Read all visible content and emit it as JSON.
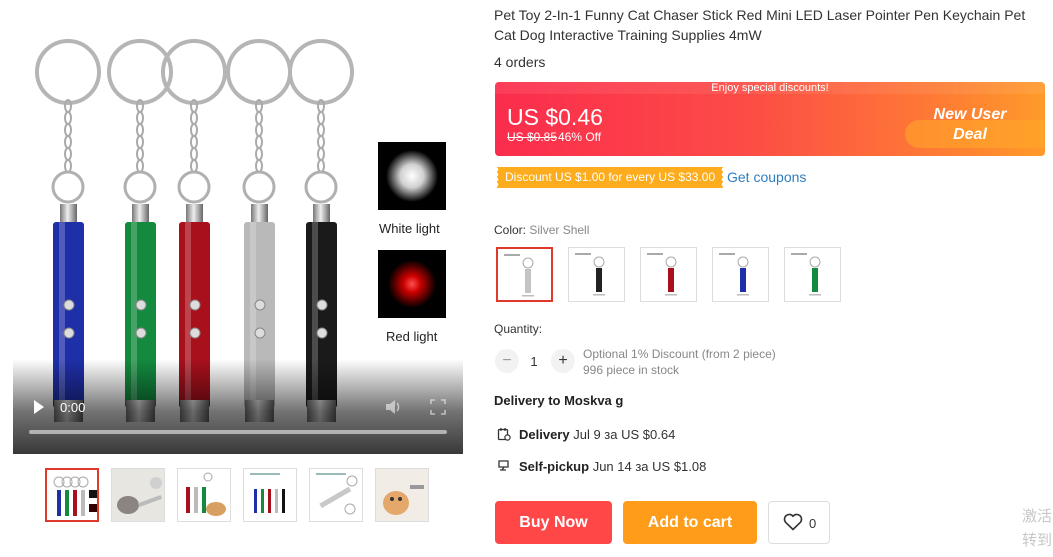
{
  "gallery": {
    "video": {
      "time": "0:00"
    },
    "lights": [
      {
        "label": "White light",
        "color": "#ffffff"
      },
      {
        "label": "Red light",
        "color": "#ff1a1a"
      }
    ],
    "pen_colors": [
      "#1e2fa8",
      "#138a3e",
      "#a8101c",
      "#b9b9b9",
      "#1a1a1a"
    ],
    "thumbnails": [
      "thumb-1",
      "thumb-2",
      "thumb-3",
      "thumb-4",
      "thumb-5",
      "thumb-6"
    ]
  },
  "product": {
    "title": "Pet Toy 2-In-1 Funny Cat Chaser Stick Red Mini LED Laser Pointer Pen Keychain Pet Cat Dog Interactive Training Supplies 4mW",
    "orders": "4 orders"
  },
  "deal": {
    "banner": "Enjoy special discounts!",
    "price": "US $0.46",
    "old_price": "US $0.85",
    "discount": "46% Off",
    "badge_line1": "New User",
    "badge_line2": "Deal"
  },
  "coupon": {
    "text": "Discount US $1.00 for every US $33.00",
    "link": "Get coupons"
  },
  "color": {
    "label": "Color:",
    "value": "Silver Shell",
    "options": [
      {
        "name": "Silver Shell",
        "pen": "#c4c4c4"
      },
      {
        "name": "Black",
        "pen": "#222222"
      },
      {
        "name": "Red",
        "pen": "#a8101c"
      },
      {
        "name": "Blue",
        "pen": "#1e2fa8"
      },
      {
        "name": "Green",
        "pen": "#138a3e"
      }
    ]
  },
  "quantity": {
    "label": "Quantity:",
    "minus": "−",
    "plus": "+",
    "value": "1",
    "note_line1": "Optional 1% Discount (from 2 piece)",
    "note_line2": "996 piece in stock"
  },
  "delivery": {
    "to": "Delivery to Moskva g",
    "rows": [
      {
        "icon": "calendar-icon",
        "title": "Delivery",
        "detail": "Jul 9 за US $0.64"
      },
      {
        "icon": "pickup-icon",
        "title": "Self-pickup",
        "detail": "Jun 14 за US $1.08"
      }
    ]
  },
  "actions": {
    "buy_now": "Buy Now",
    "add_to_cart": "Add to cart",
    "wishlist_count": "0"
  },
  "watermark": {
    "line1": "激活",
    "line2": "转到"
  },
  "colors": {
    "accent_red": "#ff4747",
    "accent_orange": "#ff9c1a",
    "coupon_orange": "#fcac1c",
    "link_blue": "#2e7ec0"
  }
}
